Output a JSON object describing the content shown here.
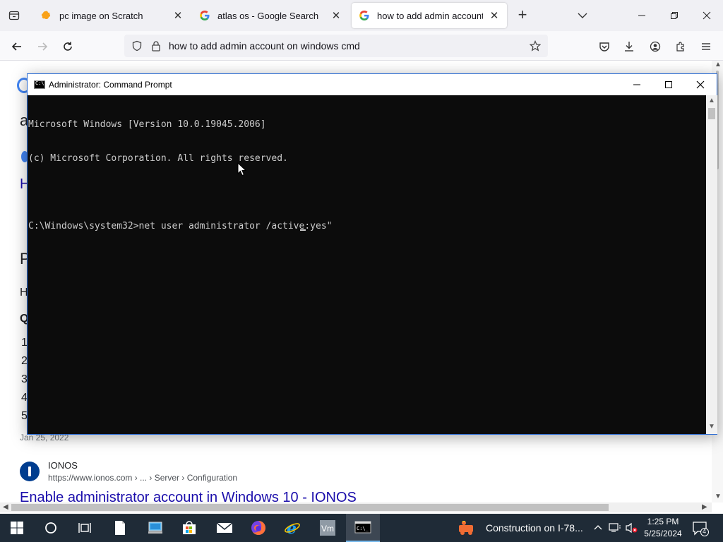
{
  "browser": {
    "tabs": [
      {
        "label": "pc image on Scratch",
        "favicon": "scratch-icon",
        "active": false
      },
      {
        "label": "atlas os - Google Search",
        "favicon": "google-icon",
        "active": false
      },
      {
        "label": "how to add admin account on",
        "favicon": "google-icon",
        "active": true
      }
    ],
    "url": "how to add admin account on windows cmd"
  },
  "page": {
    "fragments": {
      "a": "a",
      "H1": "H",
      "P": "P",
      "H2": "H",
      "Q": "Q",
      "n1": "1",
      "n2": "2",
      "n3": "3",
      "n4": "4",
      "n5": "5"
    },
    "date": "Jan 25, 2022",
    "result": {
      "site_name": "IONOS",
      "cite": "https://www.ionos.com › ... › Server › Configuration",
      "title": "Enable administrator account in Windows 10 - IONOS"
    }
  },
  "cmd": {
    "title": "Administrator: Command Prompt",
    "lines": [
      "Microsoft Windows [Version 10.0.19045.2006]",
      "(c) Microsoft Corporation. All rights reserved.",
      "",
      "C:\\Windows\\system32>net user administrator /active:yes\""
    ]
  },
  "taskbar": {
    "news": "Construction on I-78...",
    "time": "1:25 PM",
    "date": "5/25/2024",
    "notification_count": "4",
    "colors": {
      "bg": "#1f2b37",
      "accent": "#76b9ed"
    }
  }
}
